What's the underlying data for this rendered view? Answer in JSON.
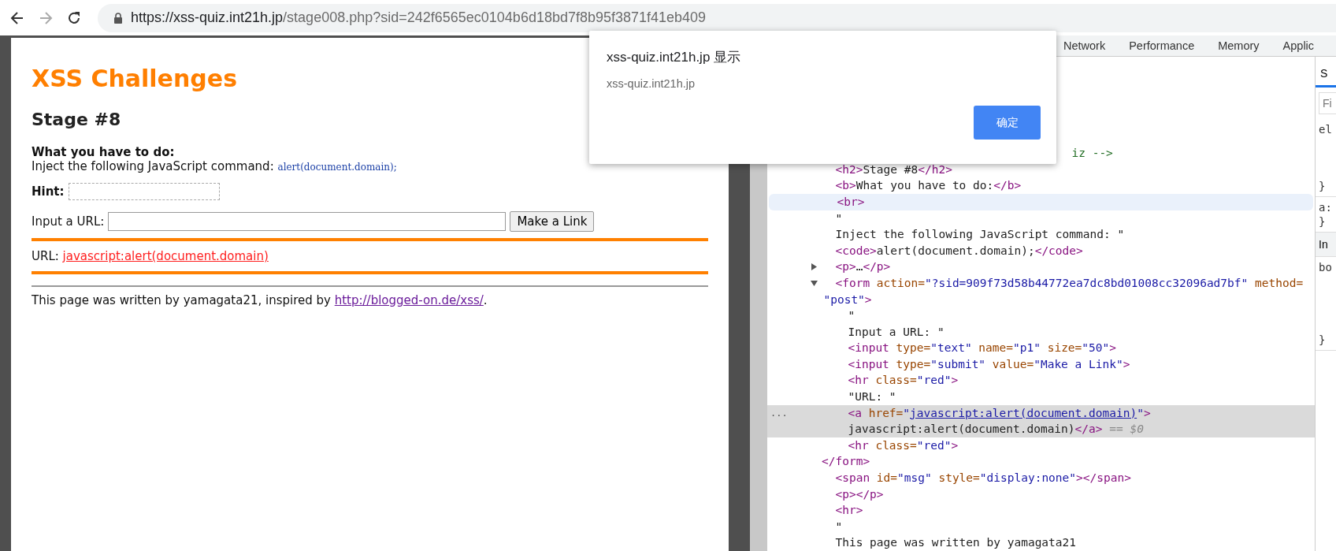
{
  "browser": {
    "url_host": "https://xss-quiz.int21h.jp",
    "url_path": "/stage008.php?sid=242f6565ec0104b6d18bd7f8b95f3871f41eb409"
  },
  "page": {
    "title": "XSS Challenges",
    "heading": "Stage #8",
    "task_label": "What you have to do:",
    "task_text": "Inject the following JavaScript command:",
    "task_code": "alert(document.domain);",
    "hint_label": "Hint:",
    "url_label": "Input a URL:",
    "submit_button": "Make a Link",
    "result_label": "URL:",
    "result_link": "javascript:alert(document.domain)",
    "footer_text": "This page was written by yamagata21, inspired by ",
    "footer_link": "http://blogged-on.de/xss/",
    "footer_end": "."
  },
  "dialog": {
    "title": "xss-quiz.int21h.jp 显示",
    "message": "xss-quiz.int21h.jp",
    "button": "确定"
  },
  "devtools": {
    "tabs": [
      "Network",
      "Performance",
      "Memory",
      "Applic"
    ],
    "selected_marker": "...",
    "nodes": [
      {
        "kind": "comment-tail",
        "selected": false,
        "hovered": false,
        "lines": [
          [
            {
              "comment": "iz -->"
            }
          ]
        ]
      },
      {
        "kind": "node",
        "selected": false,
        "hovered": false,
        "lines": [
          [
            {
              "tag": "<h2>"
            },
            {
              "text": "Stage #8"
            },
            {
              "tag": "</h2>"
            }
          ]
        ]
      },
      {
        "kind": "node",
        "selected": false,
        "hovered": false,
        "lines": [
          [
            {
              "tag": "<b>"
            },
            {
              "text": "What you have to do:"
            },
            {
              "tag": "</b>"
            }
          ]
        ]
      },
      {
        "kind": "node",
        "selected": false,
        "hovered": true,
        "lines": [
          [
            {
              "tag": "<br>"
            }
          ]
        ]
      },
      {
        "kind": "node",
        "selected": false,
        "hovered": false,
        "lines": [
          [
            {
              "text": "\""
            }
          ],
          [
            {
              "text": "Inject the following JavaScript command: \""
            }
          ]
        ]
      },
      {
        "kind": "node",
        "selected": false,
        "hovered": false,
        "lines": [
          [
            {
              "tag": "<code>"
            },
            {
              "text": "alert(document.domain);"
            },
            {
              "tag": "</code>"
            }
          ]
        ]
      },
      {
        "kind": "node",
        "selected": false,
        "hovered": false,
        "expanded": false,
        "lines": [
          [
            {
              "tag": "<p>"
            },
            {
              "text": "…"
            },
            {
              "tag": "</p>"
            }
          ]
        ]
      },
      {
        "kind": "node",
        "selected": false,
        "hovered": false,
        "expanded": true,
        "wrapped": true,
        "lines": [
          [
            {
              "tag": "<form"
            },
            {
              "attr": " action="
            },
            {
              "value": "\"?sid=909f73d58b44772ea7dc8bd01008cc32096ad7bf\""
            },
            {
              "attr": " method="
            }
          ],
          [
            {
              "value": "\"post\""
            },
            {
              "tag": ">"
            }
          ]
        ],
        "close": [
          {
            "tag": "</form>"
          }
        ],
        "children": [
          {
            "kind": "node",
            "selected": false,
            "hovered": false,
            "lines": [
              [
                {
                  "text": "\""
                }
              ],
              [
                {
                  "text": "Input a URL: \""
                }
              ]
            ]
          },
          {
            "kind": "node",
            "selected": false,
            "hovered": false,
            "lines": [
              [
                {
                  "tag": "<input"
                },
                {
                  "attr": " type="
                },
                {
                  "value": "\"text\""
                },
                {
                  "attr": " name="
                },
                {
                  "value": "\"p1\""
                },
                {
                  "attr": " size="
                },
                {
                  "value": "\"50\""
                },
                {
                  "tag": ">"
                }
              ]
            ]
          },
          {
            "kind": "node",
            "selected": false,
            "hovered": false,
            "lines": [
              [
                {
                  "tag": "<input"
                },
                {
                  "attr": " type="
                },
                {
                  "value": "\"submit\""
                },
                {
                  "attr": " value="
                },
                {
                  "value": "\"Make a Link\""
                },
                {
                  "tag": ">"
                }
              ]
            ]
          },
          {
            "kind": "node",
            "selected": false,
            "hovered": false,
            "lines": [
              [
                {
                  "tag": "<hr"
                },
                {
                  "attr": " class="
                },
                {
                  "value": "\"red\""
                },
                {
                  "tag": ">"
                }
              ]
            ]
          },
          {
            "kind": "node",
            "selected": false,
            "hovered": false,
            "lines": [
              [
                {
                  "text": "\"URL: \""
                }
              ]
            ]
          },
          {
            "kind": "node",
            "selected": true,
            "hovered": false,
            "lines": [
              [
                {
                  "tag": "<a"
                },
                {
                  "attr": " href="
                },
                {
                  "value": "\""
                },
                {
                  "link": "javascript:alert(document.domain)"
                },
                {
                  "value": "\""
                },
                {
                  "tag": ">"
                }
              ],
              [
                {
                  "text": "javascript:alert(document.domain)"
                },
                {
                  "tag": "</a>"
                },
                {
                  "dim": " == $0"
                }
              ]
            ]
          },
          {
            "kind": "node",
            "selected": false,
            "hovered": false,
            "lines": [
              [
                {
                  "tag": "<hr"
                },
                {
                  "attr": " class="
                },
                {
                  "value": "\"red\""
                },
                {
                  "tag": ">"
                }
              ]
            ]
          }
        ]
      },
      {
        "kind": "node",
        "selected": false,
        "hovered": false,
        "lines": [
          [
            {
              "tag": "<span"
            },
            {
              "attr": " id="
            },
            {
              "value": "\"msg\""
            },
            {
              "attr": " style="
            },
            {
              "value": "\"display:none\""
            },
            {
              "tag": "></span>"
            }
          ]
        ]
      },
      {
        "kind": "node",
        "selected": false,
        "hovered": false,
        "lines": [
          [
            {
              "tag": "<p></p>"
            }
          ]
        ]
      },
      {
        "kind": "node",
        "selected": false,
        "hovered": false,
        "lines": [
          [
            {
              "tag": "<hr>"
            }
          ]
        ]
      },
      {
        "kind": "node",
        "selected": false,
        "hovered": false,
        "lines": [
          [
            {
              "text": "\""
            }
          ],
          [
            {
              "text": "This page was written by yamagata21"
            }
          ]
        ]
      }
    ],
    "sidebar": {
      "tab": {
        "label": "S",
        "selected": true
      },
      "filter_placeholder": "Fi",
      "rules": [
        [
          "el",
          "}"
        ],
        [
          "a:",
          "}"
        ]
      ],
      "section": "In",
      "section_rules": [
        [
          "bo",
          "}"
        ]
      ]
    }
  }
}
